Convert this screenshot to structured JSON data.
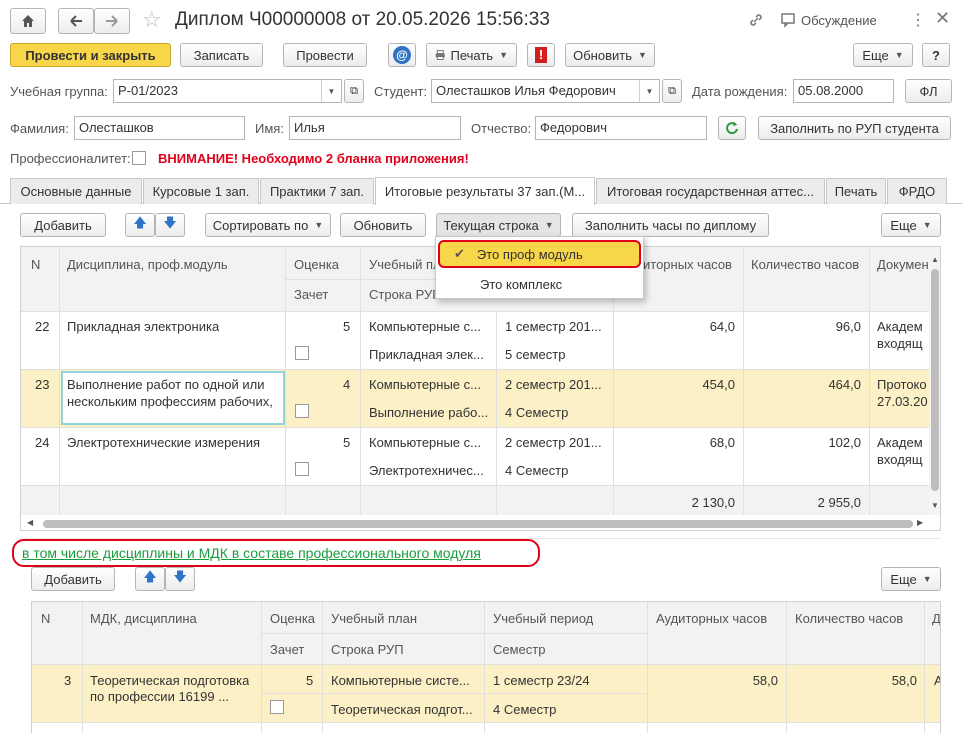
{
  "title": {
    "text": "Диплом Ч00000008 от 20.05.2026 15:56:33",
    "discussion": "Обсуждение"
  },
  "toolbar": {
    "post_close": "Провести и закрыть",
    "write": "Записать",
    "post": "Провести",
    "print": "Печать",
    "update": "Обновить",
    "more": "Еще",
    "help": "?",
    "alert": "!"
  },
  "form": {
    "group_label": "Учебная группа:",
    "group_value": "Р-01/2023",
    "student_label": "Студент:",
    "student_value": "Олесташков Илья Федорович",
    "dob_label": "Дата рождения:",
    "dob_value": "05.08.2000",
    "fl": "ФЛ",
    "surname_label": "Фамилия:",
    "surname_value": "Олесташков",
    "name_label": "Имя:",
    "name_value": "Илья",
    "patronymic_label": "Отчество:",
    "patronymic_value": "Федорович",
    "fill_rup": "Заполнить по РУП студента",
    "prof_label": "Профессионалитет:",
    "warning": "ВНИМАНИЕ! Необходимо 2 бланка приложения!"
  },
  "tabs": [
    "Основные данные",
    "Курсовые 1 зап.",
    "Практики 7 зап.",
    "Итоговые результаты 37 зап.(М...",
    "Итоговая государственная аттес...",
    "Печать",
    "ФРДО"
  ],
  "grid_toolbar": {
    "add": "Добавить",
    "sort": "Сортировать по",
    "refresh": "Обновить",
    "current_row": "Текущая строка",
    "fill_hours": "Заполнить часы по диплому",
    "more": "Еще"
  },
  "dropdown": {
    "item1": "Это проф модуль",
    "item2": "Это комплекс"
  },
  "main_grid": {
    "headers": {
      "n": "N",
      "discipline": "Дисциплина, проф.модуль",
      "grade": "Оценка",
      "grade2": "Зачет",
      "plan": "Учебный пла",
      "plan2": "Строка РУП",
      "aud_hours": "иторных часов",
      "total_hours": "Количество часов",
      "doc": "Докумен"
    },
    "rows": [
      {
        "n": "22",
        "discipline1": "Прикладная электроника",
        "discipline2": "",
        "grade": "5",
        "plan": "Компьютерные с...",
        "rup": "Прикладная элек...",
        "period": "1 семестр 201...",
        "semester": "5 семестр",
        "aud": "64,0",
        "total": "96,0",
        "doc1": "Академ",
        "doc2": "входящ"
      },
      {
        "n": "23",
        "discipline1": "Выполнение работ по одной или",
        "discipline2": "нескольким профессиям рабочих,",
        "grade": "4",
        "plan": "Компьютерные с...",
        "rup": "Выполнение рабо...",
        "period": "2 семестр 201...",
        "semester": "4 Семестр",
        "aud": "454,0",
        "total": "464,0",
        "doc1": "Протоко",
        "doc2": "27.03.20"
      },
      {
        "n": "24",
        "discipline1": "Электротехнические измерения",
        "discipline2": "",
        "grade": "5",
        "plan": "Компьютерные с...",
        "rup": "Электротехничес...",
        "period": "2 семестр 201...",
        "semester": "4 Семестр",
        "aud": "68,0",
        "total": "102,0",
        "doc1": "Академ",
        "doc2": "входящ"
      }
    ],
    "totals": {
      "aud": "2 130,0",
      "total": "2 955,0"
    }
  },
  "section_link": "в том числе дисциплины и МДК в составе профессионального модуля",
  "sub_toolbar": {
    "add": "Добавить",
    "more": "Еще"
  },
  "sub_grid": {
    "headers": {
      "n": "N",
      "mdk": "МДК, дисциплина",
      "grade": "Оценка",
      "grade2": "Зачет",
      "plan": "Учебный план",
      "plan2": "Строка РУП",
      "period": "Учебный период",
      "period2": "Семестр",
      "aud_hours": "Аудиторных часов",
      "total_hours": "Количество часов",
      "extra": "Д"
    },
    "rows": [
      {
        "n": "3",
        "mdk1": "Теоретическая подготовка",
        "mdk2": "по профессии 16199 ...",
        "grade": "5",
        "plan": "Компьютерные систе...",
        "rup": "Теоретическая подгот...",
        "period": "1 семестр 23/24",
        "semester": "4 Семестр",
        "aud": "58,0",
        "total": "58,0",
        "extra": "А"
      }
    ]
  },
  "colors": {
    "primary": "#f7d64a",
    "warning": "#e0001a",
    "link": "#1a9c3e",
    "selected_row": "#fbf0c6",
    "highlight_ring": "#e0001a"
  }
}
